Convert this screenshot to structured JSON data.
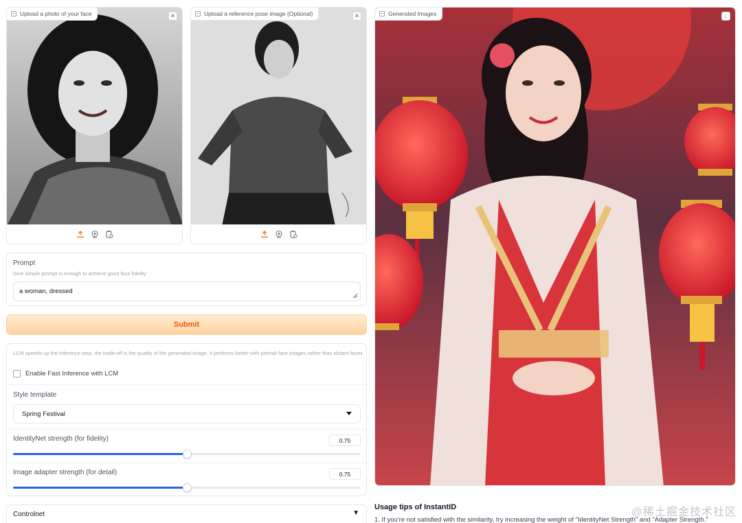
{
  "face_upload": {
    "label": "Upload a photo of your face",
    "close_symbol": "✕"
  },
  "pose_upload": {
    "label": "Upload a reference pose image (Optional)",
    "close_symbol": "✕"
  },
  "output": {
    "label": "Generated Images",
    "download_symbol": "↓"
  },
  "upload_tools": [
    "upload-icon",
    "webcam-icon",
    "clipboard-icon"
  ],
  "prompt": {
    "label": "Prompt",
    "info": "Give simple prompt is enough to achieve good face fidelity",
    "value": "a woman, dressed"
  },
  "submit_label": "Submit",
  "lcm": {
    "info": "LCM speeds up the inference step, the trade-off is the quality of the generated image. It performs better with portrait face images rather than distant faces",
    "checkbox_label": "Enable Fast Inference with LCM",
    "checked": false
  },
  "style_template": {
    "label": "Style template",
    "selected": "Spring Festival"
  },
  "identitynet": {
    "label": "IdentityNet strength (for fidelity)",
    "value": "0.75",
    "fraction": 0.5
  },
  "adapter": {
    "label": "Image adapter strength (for detail)",
    "value": "0.75",
    "fraction": 0.5
  },
  "controlnet": {
    "label": "Controlnet",
    "arrow": "▼"
  },
  "tips": {
    "heading": "Usage tips of InstantID",
    "line1": "1. If you're not satisfied with the similarity, try increasing the weight of \"IdentityNet Strength\" and \"Adapter Strength.\""
  },
  "watermark": "@稀土掘金技术社区",
  "colors": {
    "accent": "#2563eb",
    "submit_text": "#ea580c",
    "submit_bg": "#fdd2a0"
  }
}
